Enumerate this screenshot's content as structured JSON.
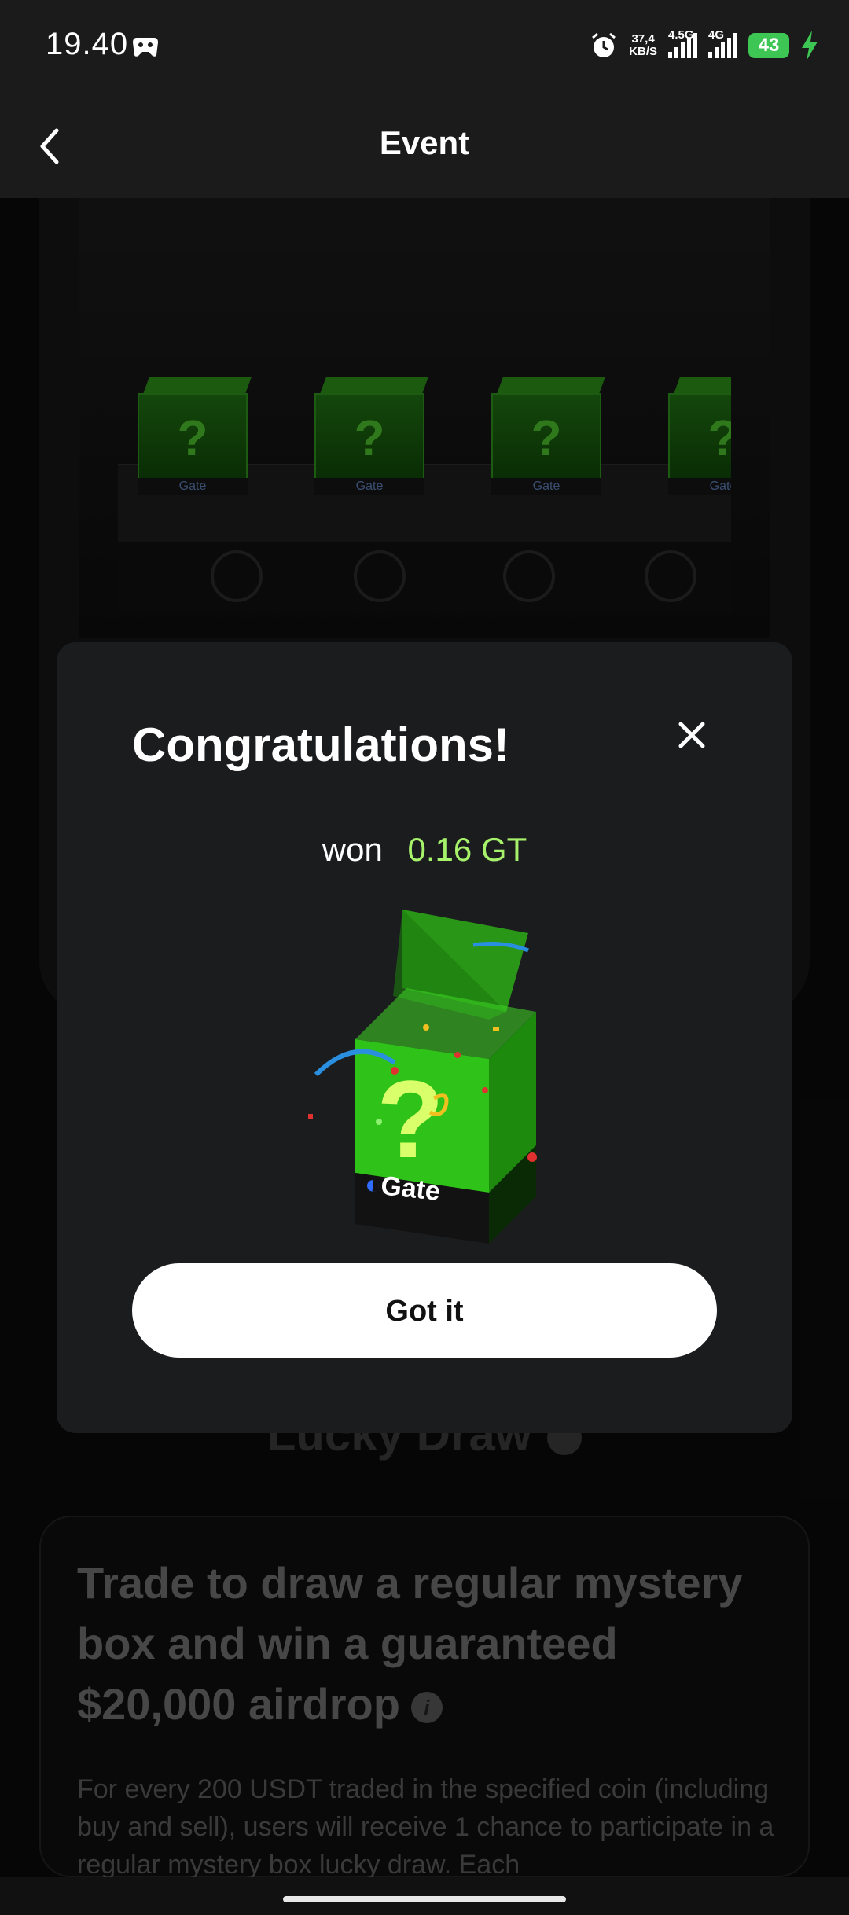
{
  "status_bar": {
    "time": "19.40",
    "net_speed_value": "37,4",
    "net_speed_unit": "KB/S",
    "net1": "4.5G",
    "net2": "4G",
    "battery": "43"
  },
  "header": {
    "title": "Event"
  },
  "background": {
    "box_brand": "Gate",
    "box_symbol": "?",
    "section_title": "Lucky Draw",
    "card_title": "Trade to draw a regular mystery box and win a guaranteed $20,000 airdrop",
    "card_text": "For every 200 USDT traded in the specified coin (including buy and sell), users will receive 1 chance to participate in a regular mystery box lucky draw. Each"
  },
  "modal": {
    "title": "Congratulations!",
    "won_label": "won",
    "amount": "0.16 GT",
    "prize_brand": "Gate",
    "button_label": "Got it"
  },
  "colors": {
    "accent": "#a7f26b",
    "box_green": "#39d21f",
    "modal_bg": "#1b1c1e"
  }
}
